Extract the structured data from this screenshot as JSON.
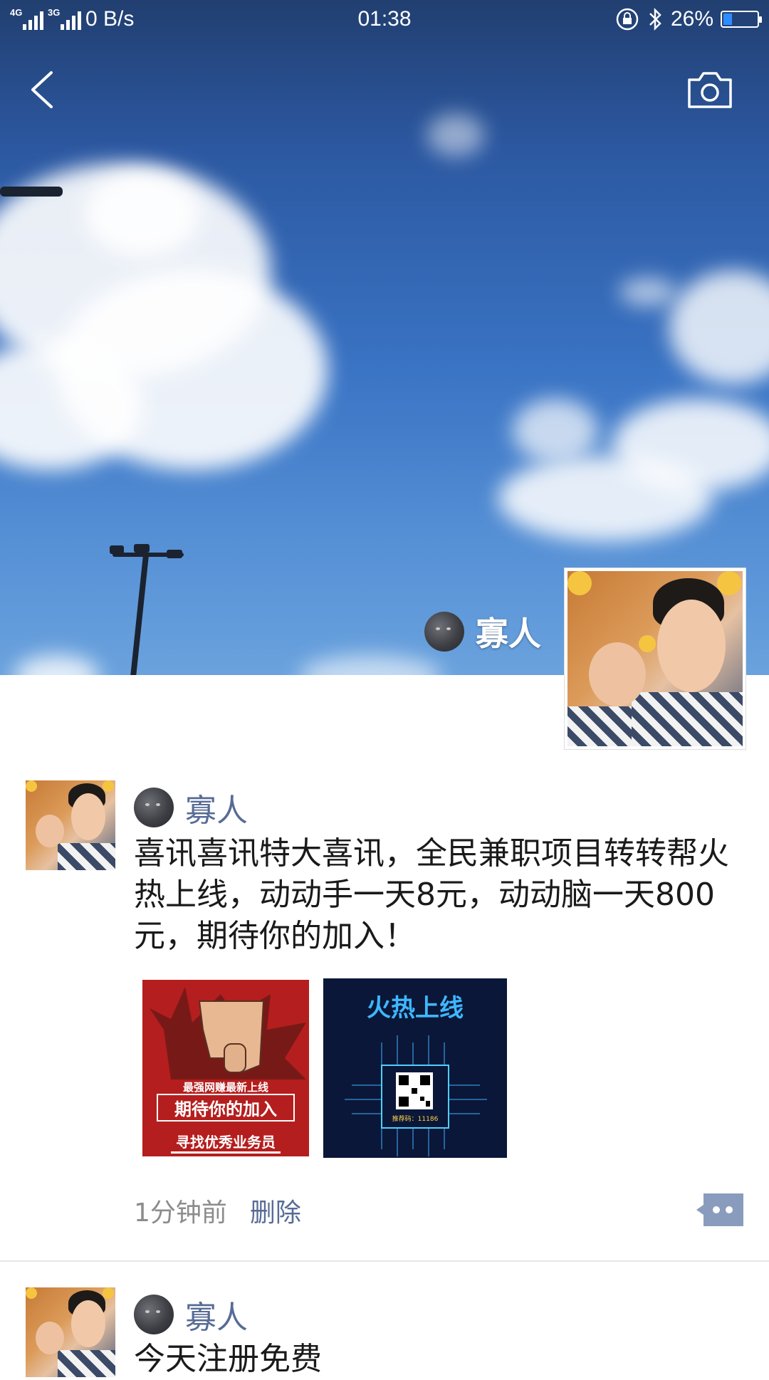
{
  "status_bar": {
    "network_1": "4G",
    "network_2": "3G",
    "speed": "0 B/s",
    "time": "01:38",
    "battery_percent": "26%",
    "battery_level": 0.26
  },
  "profile": {
    "name": "寡人"
  },
  "posts": [
    {
      "author": "寡人",
      "text": "喜讯喜讯特大喜讯，全民兼职项目转转帮火热上线，动动手一天8元，动动脑一天800元，期待你的加入！",
      "images": [
        {
          "lines": [
            "最强网赚最新上线",
            "期待你的加入",
            "寻找优秀业务员"
          ]
        },
        {
          "lines": [
            "火热上线",
            "推荐码：11186"
          ]
        }
      ],
      "time": "1分钟前",
      "delete_label": "删除"
    },
    {
      "author": "寡人",
      "text": "今天注册免费"
    }
  ]
}
